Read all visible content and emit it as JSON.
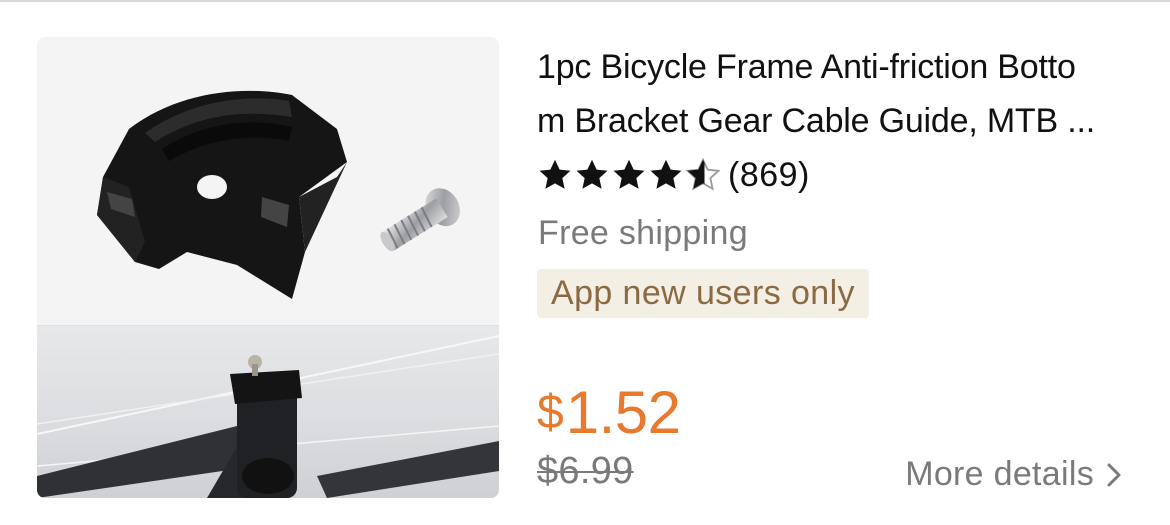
{
  "product": {
    "title_line1": "1pc Bicycle Frame Anti-friction Botto",
    "title_line2": "m Bracket Gear Cable Guide, MTB ...",
    "rating_stars": 4.5,
    "review_count": "(869)",
    "shipping": "Free shipping",
    "promo_badge": "App new users only",
    "price_currency": "$",
    "price_value": "1.52",
    "original_price": "$6.99",
    "more_details": "More details",
    "image_icon": "product-photo"
  },
  "colors": {
    "price": "#e8792d",
    "muted_text": "#7a7a7a",
    "badge_bg": "#f4efe5",
    "badge_text": "#8a6a43"
  }
}
